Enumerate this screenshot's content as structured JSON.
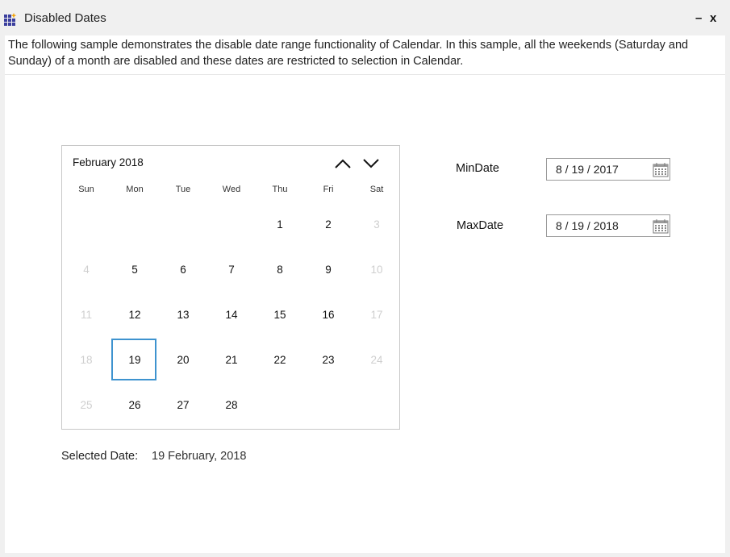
{
  "window": {
    "title": "Disabled Dates",
    "minimize_label": "–",
    "close_label": "x",
    "icon": "app-grid-icon"
  },
  "description": "The following sample demonstrates the disable date range functionality of Calendar. In this sample, all the weekends (Saturday and Sunday)  of a month are disabled and these dates are restricted to selection in Calendar.",
  "calendar": {
    "header": "February  2018",
    "nav_up_icon": "chevron-up-icon",
    "nav_down_icon": "chevron-down-icon",
    "weekdays": [
      "Sun",
      "Mon",
      "Tue",
      "Wed",
      "Thu",
      "Fri",
      "Sat"
    ],
    "first_weekday_index": 4,
    "days": [
      {
        "label": "1",
        "disabled": false
      },
      {
        "label": "2",
        "disabled": false
      },
      {
        "label": "3",
        "disabled": true
      },
      {
        "label": "4",
        "disabled": true
      },
      {
        "label": "5",
        "disabled": false
      },
      {
        "label": "6",
        "disabled": false
      },
      {
        "label": "7",
        "disabled": false
      },
      {
        "label": "8",
        "disabled": false
      },
      {
        "label": "9",
        "disabled": false
      },
      {
        "label": "10",
        "disabled": true
      },
      {
        "label": "11",
        "disabled": true
      },
      {
        "label": "12",
        "disabled": false
      },
      {
        "label": "13",
        "disabled": false
      },
      {
        "label": "14",
        "disabled": false
      },
      {
        "label": "15",
        "disabled": false
      },
      {
        "label": "16",
        "disabled": false
      },
      {
        "label": "17",
        "disabled": true
      },
      {
        "label": "18",
        "disabled": true
      },
      {
        "label": "19",
        "disabled": false,
        "selected": true
      },
      {
        "label": "20",
        "disabled": false
      },
      {
        "label": "21",
        "disabled": false
      },
      {
        "label": "22",
        "disabled": false
      },
      {
        "label": "23",
        "disabled": false
      },
      {
        "label": "24",
        "disabled": true
      },
      {
        "label": "25",
        "disabled": true
      },
      {
        "label": "26",
        "disabled": false
      },
      {
        "label": "27",
        "disabled": false
      },
      {
        "label": "28",
        "disabled": false
      }
    ],
    "selection_color": "#3e93cf",
    "disabled_color": "#cfcfcf"
  },
  "selected": {
    "label": "Selected Date:",
    "value": "19 February, 2018"
  },
  "fields": {
    "min": {
      "label": "MinDate",
      "value": "8 / 19 / 2017",
      "icon": "calendar-icon"
    },
    "max": {
      "label": "MaxDate",
      "value": "8 / 19 / 2018",
      "icon": "calendar-icon"
    }
  }
}
